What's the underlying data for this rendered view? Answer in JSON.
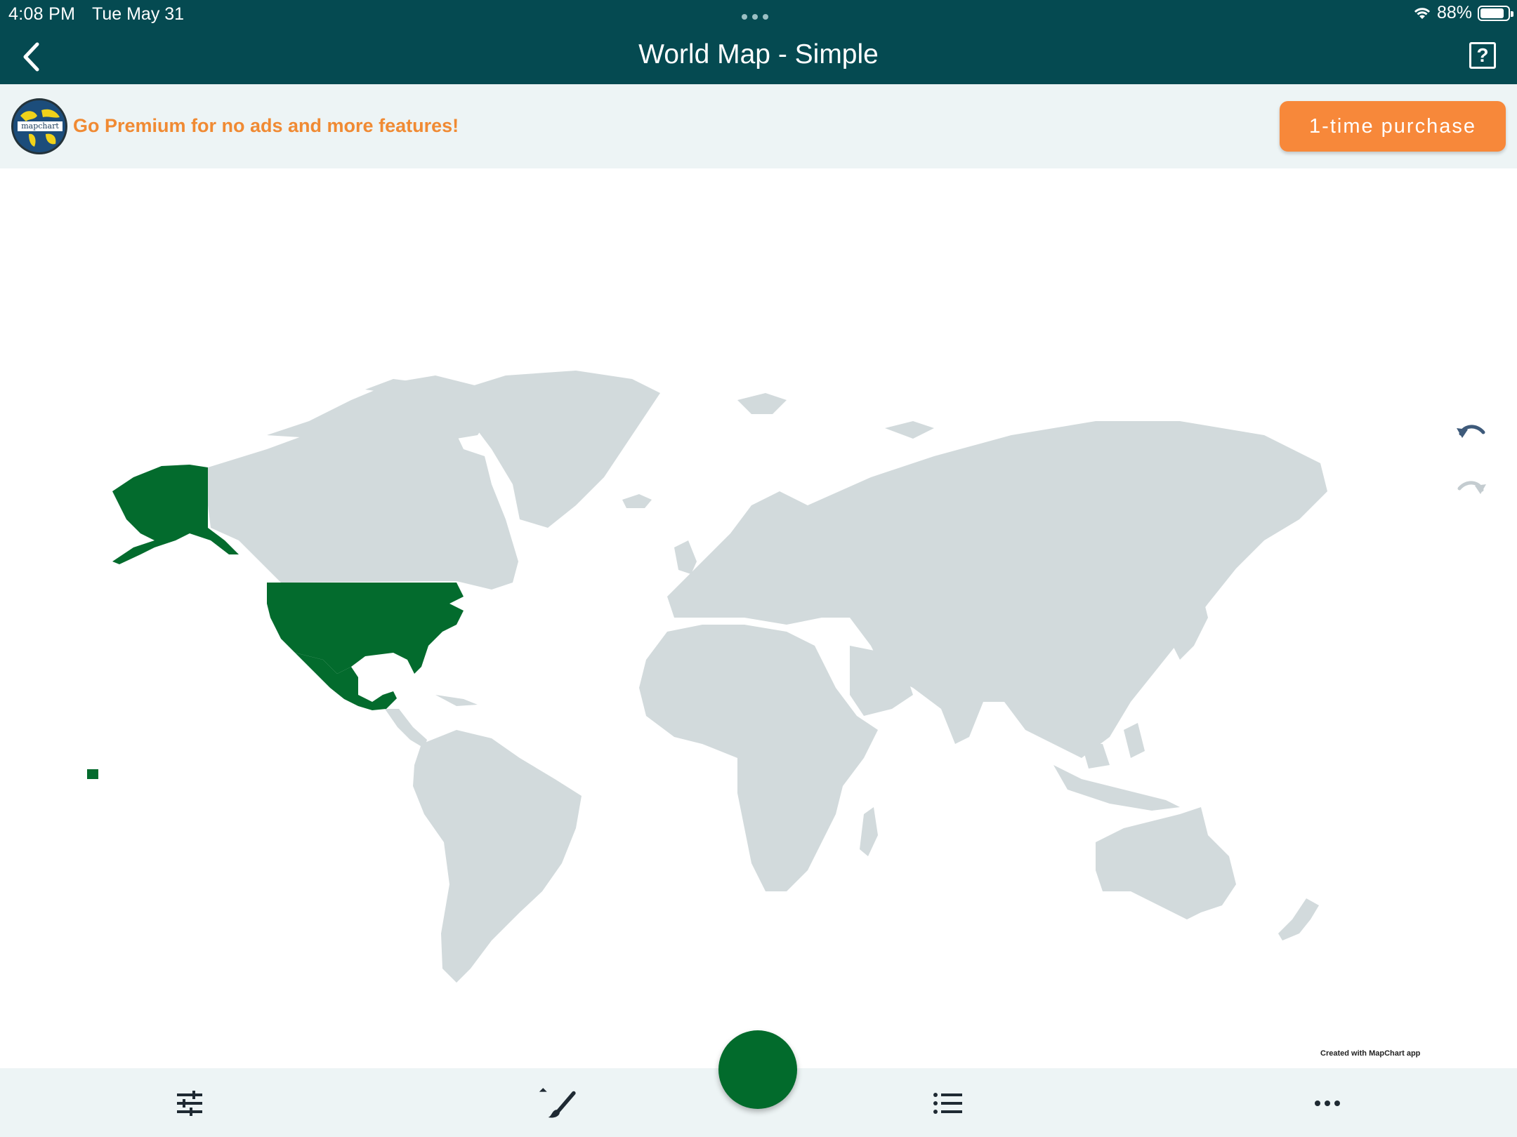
{
  "status": {
    "time": "4:08 PM",
    "date": "Tue May 31",
    "battery": "88%",
    "battery_level": 0.88
  },
  "nav": {
    "title": "World Map - Simple",
    "back_icon": "chevron-left-icon",
    "help_icon": "question-square-icon",
    "help_glyph": "?"
  },
  "banner": {
    "logo_text": "mapchart",
    "message": "Go Premium for no ads and more features!",
    "purchase_label": "1-time purchase"
  },
  "map": {
    "credit": "Created with MapChart app",
    "selected_color": "#036b2d",
    "land_color": "#d2dadc",
    "selected_regions": [
      "Alaska",
      "United States",
      "Mexico",
      "Hawaii"
    ]
  },
  "toolbar": {
    "items": [
      {
        "icon": "sliders-icon"
      },
      {
        "icon": "paintbrush-icon"
      },
      {
        "icon": "color-picker-fab"
      },
      {
        "icon": "list-icon"
      },
      {
        "icon": "more-icon"
      }
    ]
  },
  "side_controls": {
    "undo_icon": "undo-icon",
    "redo_icon": "redo-icon"
  },
  "colors": {
    "header": "#054a51",
    "banner_bg": "#edf4f5",
    "accent": "#f7883a",
    "fab": "#026b2c"
  }
}
